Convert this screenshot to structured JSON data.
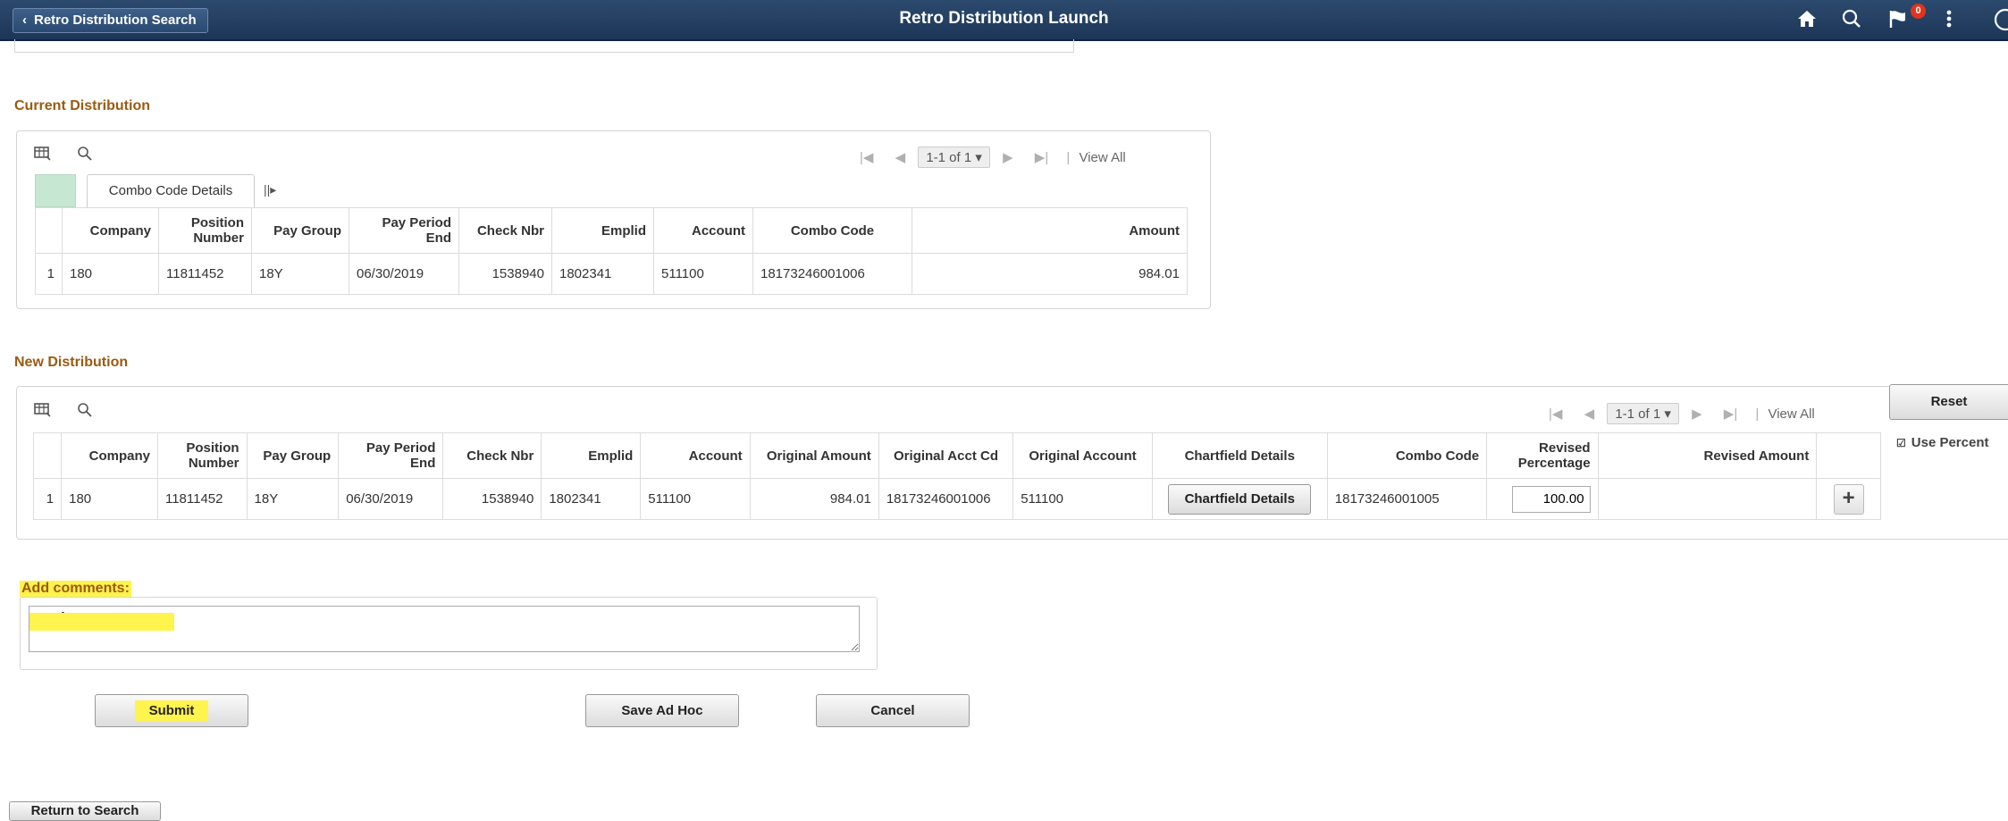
{
  "header": {
    "back_label": "Retro Distribution Search",
    "title": "Retro Distribution Launch",
    "notification_count": "0"
  },
  "current": {
    "title": "Current Distribution",
    "tab_label": "Combo Code Details",
    "pager": "1-1 of 1",
    "view_all": "View All",
    "columns": [
      "Company",
      "Position Number",
      "Pay Group",
      "Pay Period End",
      "Check Nbr",
      "Emplid",
      "Account",
      "Combo Code",
      "Amount"
    ],
    "rows": [
      {
        "num": "1",
        "company": "180",
        "position": "11811452",
        "pay_group": "18Y",
        "pay_period_end": "06/30/2019",
        "check_nbr": "1538940",
        "emplid": "1802341",
        "account": "511100",
        "combo_code": "18173246001006",
        "amount": "984.01"
      }
    ]
  },
  "new": {
    "title": "New Distribution",
    "pager": "1-1 of 1",
    "view_all": "View All",
    "columns": [
      "Company",
      "Position Number",
      "Pay Group",
      "Pay Period End",
      "Check Nbr",
      "Emplid",
      "Account",
      "Original Amount",
      "Original Acct Cd",
      "Original Account",
      "Chartfield Details",
      "Combo Code",
      "Revised Percentage",
      "Revised Amount"
    ],
    "rows": [
      {
        "num": "1",
        "company": "180",
        "position": "11811452",
        "pay_group": "18Y",
        "pay_period_end": "06/30/2019",
        "check_nbr": "1538940",
        "emplid": "1802341",
        "account": "511100",
        "original_amount": "984.01",
        "original_acct_cd": "18173246001006",
        "original_account": "511100",
        "chartfield_button": "Chartfield Details",
        "combo_code": "18173246001005",
        "revised_percentage": "100.00",
        "revised_amount": ""
      }
    ],
    "reset_label": "Reset",
    "use_percent_label": "Use Percent"
  },
  "comments": {
    "label": "Add comments:",
    "value": "test for InterACT"
  },
  "actions": {
    "submit": "Submit",
    "save_ad_hoc": "Save Ad Hoc",
    "cancel": "Cancel",
    "return_to_search": "Return to Search"
  }
}
